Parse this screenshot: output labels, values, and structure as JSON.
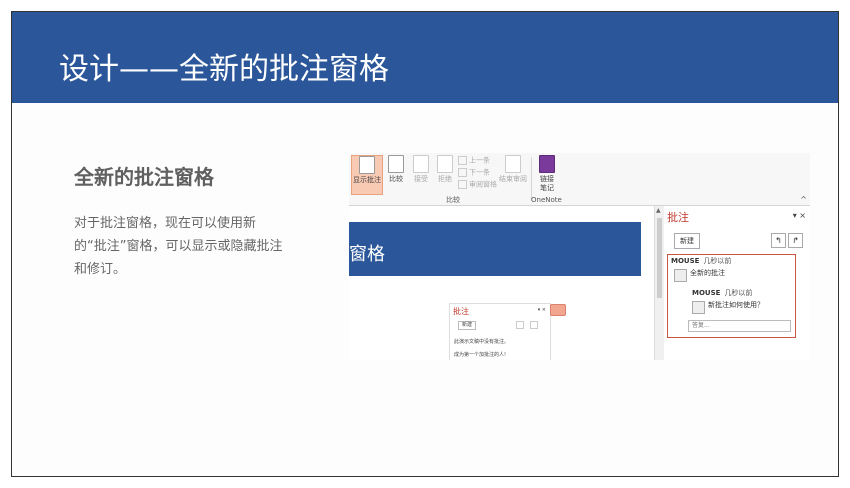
{
  "banner": {
    "title": "设计——全新的批注窗格"
  },
  "content": {
    "heading": "全新的批注窗格",
    "description": "对于批注窗格，现在可以使用新的“批注”窗格，可以显示或隐藏批注和修订。"
  },
  "ribbon": {
    "show_comments": "显示批注",
    "compare": "比较",
    "accept": "接受",
    "reject": "拒绝",
    "previous": "上一条",
    "next": "下一条",
    "reviewing_pane": "审阅窗格",
    "end_review": "结束审阅",
    "onenote_link_line1": "链接",
    "onenote_link_line2": "笔记",
    "group_compare": "比较",
    "group_onenote": "OneNote"
  },
  "document": {
    "heading_fragment": "窗格"
  },
  "mini_pane": {
    "title": "批注",
    "new_label": "新建",
    "message1": "此演示文稿中没有批注。",
    "message2": "成为第一个加批注的人!"
  },
  "comments_pane": {
    "title": "批注",
    "new_label": "新建",
    "comment1": {
      "author": "MOUSE",
      "time": "几秒以前",
      "text": "全新的批注"
    },
    "comment2": {
      "author": "MOUSE",
      "time": "几秒以前",
      "text": "新批注如何使用？"
    },
    "reply_placeholder": "答复..."
  }
}
